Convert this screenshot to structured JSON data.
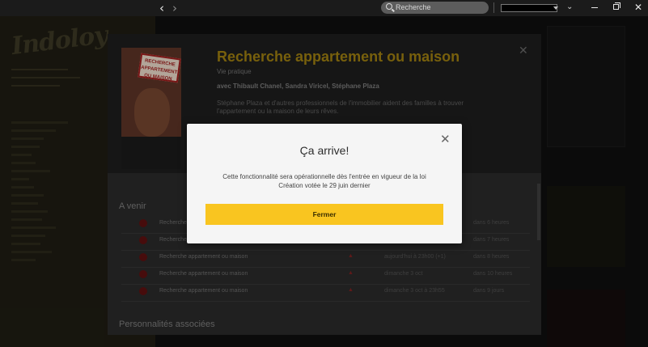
{
  "titlebar": {
    "back_glyph": "‹",
    "forward_glyph": "›",
    "search_placeholder": "Recherche",
    "chevron_glyph": "⌄",
    "close_glyph": "✕"
  },
  "detail": {
    "show_title": "Recherche appartement ou maison",
    "genre": "Vie pratique",
    "cast": "avec Thibault Chanel, Sandra Viricel, Stéphane Plaza",
    "description": "Stéphane Plaza et d'autres professionnels de l'immobilier aident des familles à trouver l'appartement ou la maison de leurs rêves.",
    "thumb_tag": "RECHERCHE APPARTEMENT OU MAISON",
    "close_glyph": "✕",
    "upcoming_heading": "A venir",
    "episodes": [
      {
        "title": "Recherche appartement ou maison",
        "date": "",
        "rel": "dans 6 heures"
      },
      {
        "title": "Recherche appartement ou maison",
        "date": "",
        "rel": "dans 7 heures"
      },
      {
        "title": "Recherche appartement ou maison",
        "date": "aujourd'hui à 23h00 (+1)",
        "rel": "dans 8 heures"
      },
      {
        "title": "Recherche appartement ou maison",
        "date": "dimanche 3 oct",
        "rel": "dans 10 heures"
      },
      {
        "title": "Recherche appartement ou maison",
        "date": "dimanche 3 oct à 23h55",
        "rel": "dans 9 jours"
      }
    ],
    "people_heading": "Personnalités associées"
  },
  "modal": {
    "title": "Ça arrive!",
    "close_glyph": "✕",
    "body_line1": "Cette fonctionnalité sera opérationnelle dès l'entrée en vigueur de la loi",
    "body_line2": "Création votée le 29 juin dernier",
    "button_label": "Fermer"
  },
  "colors": {
    "accent": "#f9c520",
    "modal_bg": "#f5f5f5",
    "overlay": "#000000"
  }
}
